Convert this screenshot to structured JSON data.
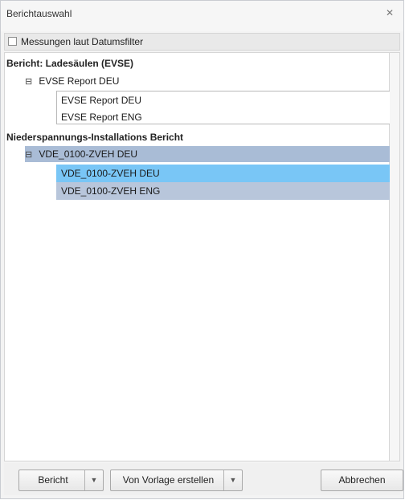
{
  "window": {
    "title": "Berichtauswahl",
    "close_icon": "close-icon"
  },
  "filter": {
    "label": "Messungen laut Datumsfilter",
    "checked": false
  },
  "tree": {
    "sections": [
      {
        "label": "Bericht: Ladesäulen (EVSE)",
        "group": {
          "label": "EVSE Report DEU",
          "expanded": true,
          "children": [
            "EVSE Report DEU",
            "EVSE Report ENG"
          ]
        }
      },
      {
        "label": "Niederspannungs-Installations Bericht",
        "group": {
          "label": "VDE_0100-ZVEH DEU",
          "expanded": true,
          "children": [
            "VDE_0100-ZVEH DEU",
            "VDE_0100-ZVEH ENG"
          ]
        }
      }
    ],
    "toggle_symbol": "⊟"
  },
  "footer": {
    "bericht_label": "Bericht",
    "vorlage_label": "Von Vorlage erstellen",
    "abbrechen_label": "Abbrechen",
    "dropdown_symbol": "▼"
  },
  "colors": {
    "selected_group": "#a9bcd6",
    "selected_item": "#79c6f6",
    "selected_item_secondary": "#b8c6db"
  }
}
